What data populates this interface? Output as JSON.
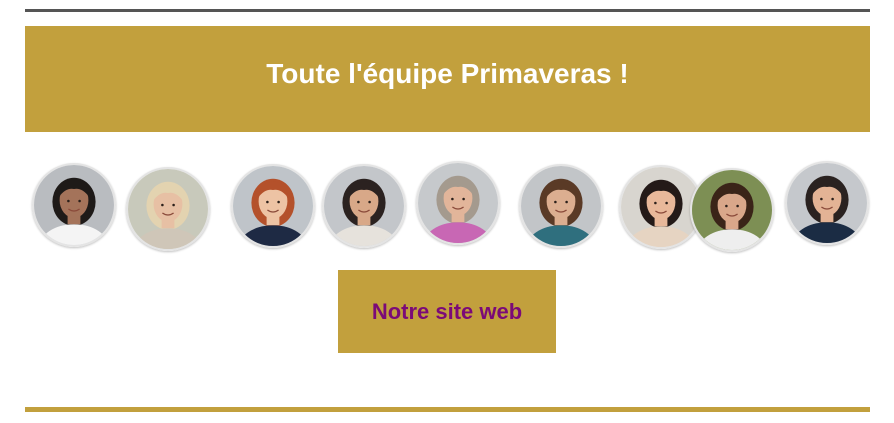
{
  "banner": {
    "title": "Toute l'équipe Primaveras !"
  },
  "team": {
    "members": [
      {
        "icon": "person-portrait-icon",
        "bg": "#b9bcc0",
        "skin": "#a4735a",
        "hair": "#1e1a18",
        "top": "#f4f4f4"
      },
      {
        "icon": "person-portrait-icon",
        "bg": "#c8c9bb",
        "skin": "#e7c0a4",
        "hair": "#e3d3b0",
        "top": "#cfc6b8"
      },
      {
        "icon": "person-portrait-icon",
        "bg": "#bfc4c9",
        "skin": "#edc3a4",
        "hair": "#b4512b",
        "top": "#1e2a44"
      },
      {
        "icon": "person-portrait-icon",
        "bg": "#c3c6ca",
        "skin": "#d8a888",
        "hair": "#2b2220",
        "top": "#e6e2dc"
      },
      {
        "icon": "person-portrait-icon",
        "bg": "#c6c9cc",
        "skin": "#e2b59a",
        "hair": "#a49a8e",
        "top": "#c867b4"
      },
      {
        "icon": "person-portrait-icon",
        "bg": "#c2c5c8",
        "skin": "#dcae90",
        "hair": "#5a3a26",
        "top": "#2f6f7e"
      },
      {
        "icon": "person-portrait-icon",
        "bg": "#d8d5cf",
        "skin": "#e8b89a",
        "hair": "#241a18",
        "top": "#e6d4c2"
      },
      {
        "icon": "person-portrait-icon",
        "bg": "#7d8f54",
        "skin": "#d9a78a",
        "hair": "#3a2418",
        "top": "#eeeeee"
      },
      {
        "icon": "person-portrait-icon",
        "bg": "#c5c8cc",
        "skin": "#e3b395",
        "hair": "#2a2220",
        "top": "#1b2c44"
      }
    ]
  },
  "cta": {
    "label": "Notre site web"
  },
  "colors": {
    "gold": "#c2a03d",
    "cta_text": "#7b0a78",
    "top_rule": "#555555"
  }
}
